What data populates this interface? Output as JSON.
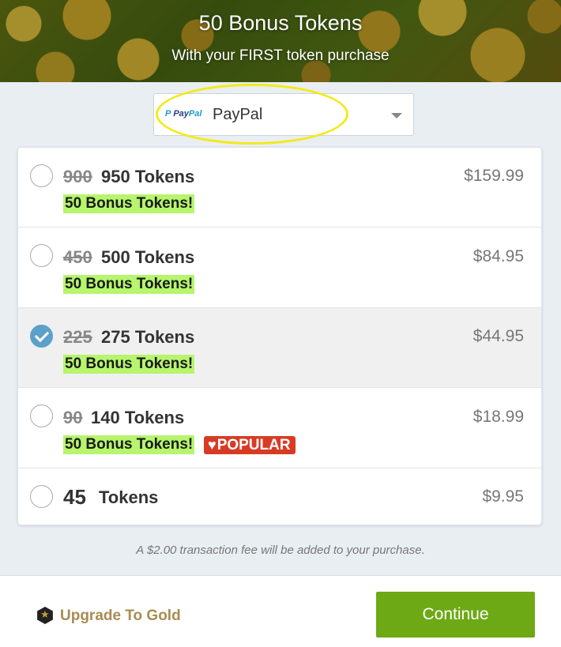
{
  "banner": {
    "title": "50 Bonus Tokens",
    "subtitle": "With your FIRST token purchase"
  },
  "payment": {
    "logo_text_1": "Pay",
    "logo_text_2": "Pal",
    "selected": "PayPal",
    "highlight_color": "#f2ea1a"
  },
  "options": [
    {
      "old": "900",
      "tokens": "950 Tokens",
      "price": "$159.99",
      "bonus": "50 Bonus Tokens!",
      "selected": false
    },
    {
      "old": "450",
      "tokens": "500 Tokens",
      "price": "$84.95",
      "bonus": "50 Bonus Tokens!",
      "selected": false
    },
    {
      "old": "225",
      "tokens": "275 Tokens",
      "price": "$44.95",
      "bonus": "50 Bonus Tokens!",
      "selected": true
    },
    {
      "old": "90",
      "tokens": "140 Tokens",
      "price": "$18.99",
      "bonus": "50 Bonus Tokens!",
      "badge": "POPULAR",
      "selected": false
    },
    {
      "tokens_num": "45",
      "tokens_word": "Tokens",
      "price": "$9.95",
      "selected": false
    }
  ],
  "fee_note": "A $2.00 transaction fee will be added to your purchase.",
  "footer": {
    "upgrade_label": "Upgrade To Gold",
    "continue_label": "Continue"
  },
  "colors": {
    "accent": "#6da914",
    "bonus_bg": "#b6f56c",
    "badge_bg": "#d83b24",
    "selected_radio": "#5ba1c9",
    "gold": "#a88c52"
  }
}
